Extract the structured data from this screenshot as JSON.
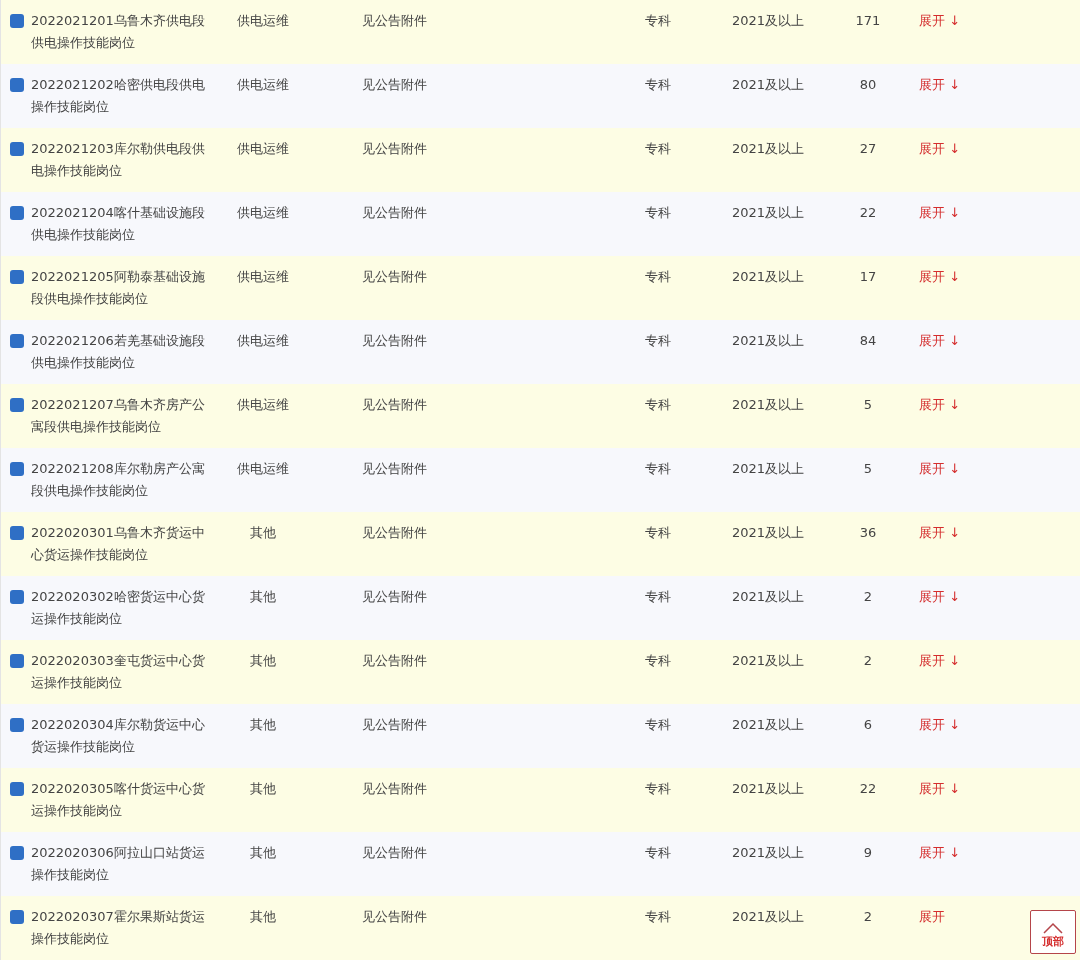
{
  "rows": [
    {
      "position": "2022021201乌鲁木齐供电段供电操作技能岗位",
      "category": "供电运维",
      "major": "见公告附件",
      "education": "专科",
      "graduation": "2021及以上",
      "count": "171",
      "toggle": "展开 ↓"
    },
    {
      "position": "2022021202哈密供电段供电操作技能岗位",
      "category": "供电运维",
      "major": "见公告附件",
      "education": "专科",
      "graduation": "2021及以上",
      "count": "80",
      "toggle": "展开 ↓"
    },
    {
      "position": "2022021203库尔勒供电段供电操作技能岗位",
      "category": "供电运维",
      "major": "见公告附件",
      "education": "专科",
      "graduation": "2021及以上",
      "count": "27",
      "toggle": "展开 ↓"
    },
    {
      "position": "2022021204喀什基础设施段供电操作技能岗位",
      "category": "供电运维",
      "major": "见公告附件",
      "education": "专科",
      "graduation": "2021及以上",
      "count": "22",
      "toggle": "展开 ↓"
    },
    {
      "position": "2022021205阿勒泰基础设施段供电操作技能岗位",
      "category": "供电运维",
      "major": "见公告附件",
      "education": "专科",
      "graduation": "2021及以上",
      "count": "17",
      "toggle": "展开 ↓"
    },
    {
      "position": "2022021206若羌基础设施段供电操作技能岗位",
      "category": "供电运维",
      "major": "见公告附件",
      "education": "专科",
      "graduation": "2021及以上",
      "count": "84",
      "toggle": "展开 ↓"
    },
    {
      "position": "2022021207乌鲁木齐房产公寓段供电操作技能岗位",
      "category": "供电运维",
      "major": "见公告附件",
      "education": "专科",
      "graduation": "2021及以上",
      "count": "5",
      "toggle": "展开 ↓"
    },
    {
      "position": "2022021208库尔勒房产公寓段供电操作技能岗位",
      "category": "供电运维",
      "major": "见公告附件",
      "education": "专科",
      "graduation": "2021及以上",
      "count": "5",
      "toggle": "展开 ↓"
    },
    {
      "position": "2022020301乌鲁木齐货运中心货运操作技能岗位",
      "category": "其他",
      "major": "见公告附件",
      "education": "专科",
      "graduation": "2021及以上",
      "count": "36",
      "toggle": "展开 ↓"
    },
    {
      "position": "2022020302哈密货运中心货运操作技能岗位",
      "category": "其他",
      "major": "见公告附件",
      "education": "专科",
      "graduation": "2021及以上",
      "count": "2",
      "toggle": "展开 ↓"
    },
    {
      "position": "2022020303奎屯货运中心货运操作技能岗位",
      "category": "其他",
      "major": "见公告附件",
      "education": "专科",
      "graduation": "2021及以上",
      "count": "2",
      "toggle": "展开 ↓"
    },
    {
      "position": "2022020304库尔勒货运中心货运操作技能岗位",
      "category": "其他",
      "major": "见公告附件",
      "education": "专科",
      "graduation": "2021及以上",
      "count": "6",
      "toggle": "展开 ↓"
    },
    {
      "position": "2022020305喀什货运中心货运操作技能岗位",
      "category": "其他",
      "major": "见公告附件",
      "education": "专科",
      "graduation": "2021及以上",
      "count": "22",
      "toggle": "展开 ↓"
    },
    {
      "position": "2022020306阿拉山口站货运操作技能岗位",
      "category": "其他",
      "major": "见公告附件",
      "education": "专科",
      "graduation": "2021及以上",
      "count": "9",
      "toggle": "展开 ↓"
    },
    {
      "position": "2022020307霍尔果斯站货运操作技能岗位",
      "category": "其他",
      "major": "见公告附件",
      "education": "专科",
      "graduation": "2021及以上",
      "count": "2",
      "toggle": "展开"
    }
  ],
  "back_to_top": {
    "label": "顶部"
  }
}
